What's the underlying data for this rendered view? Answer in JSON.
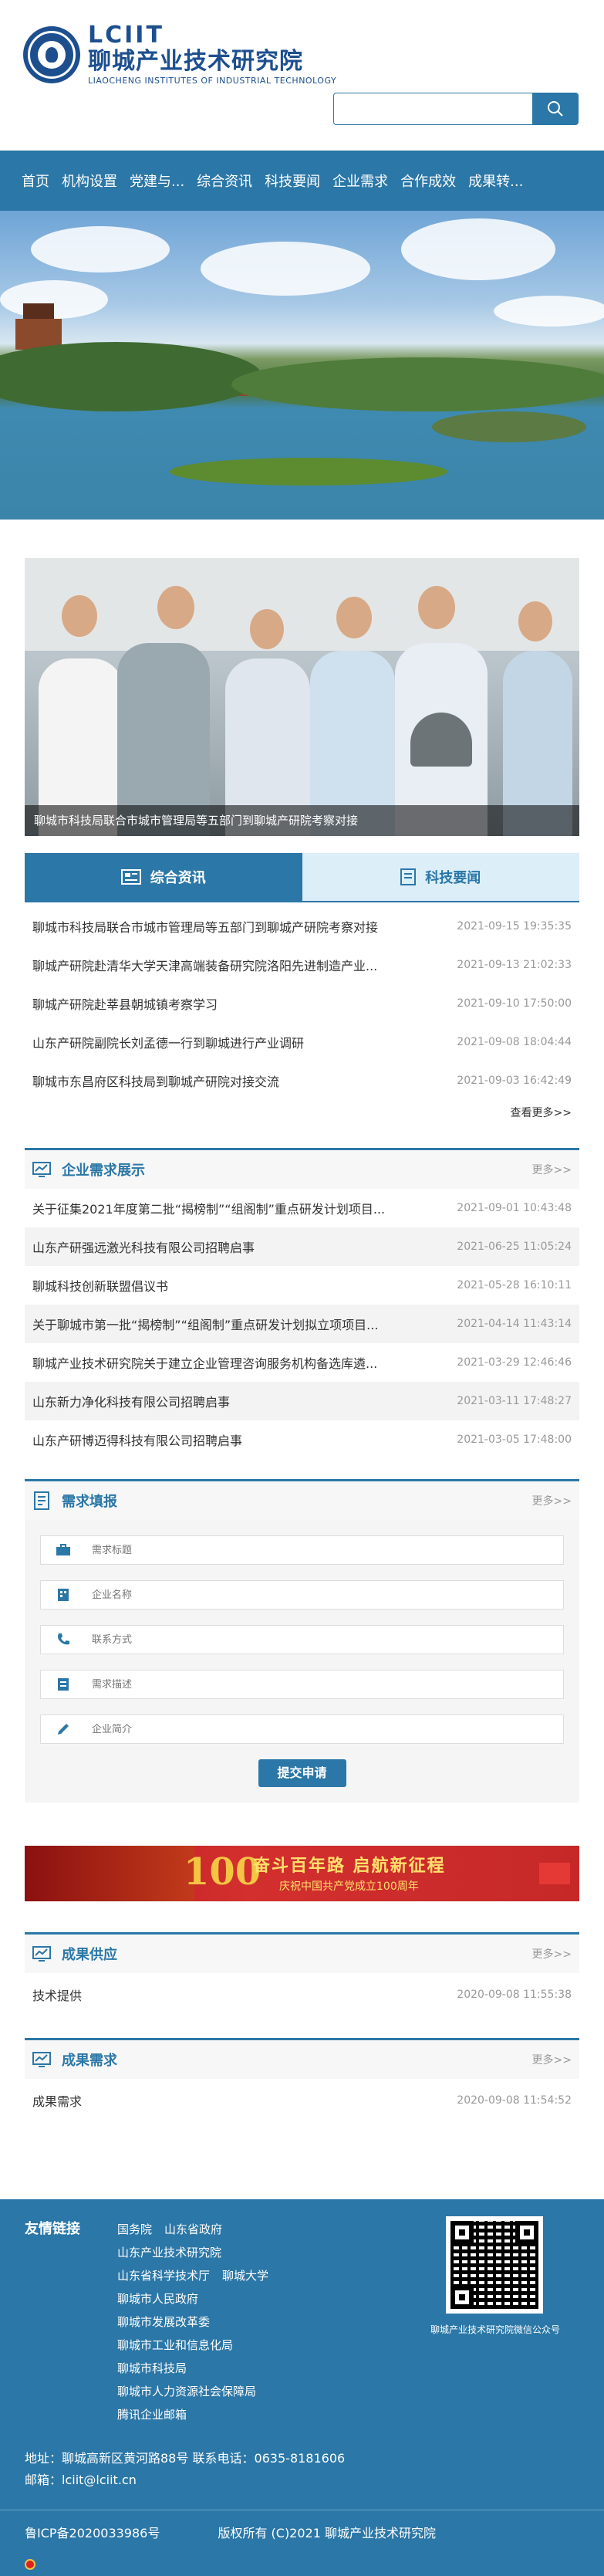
{
  "header": {
    "logo_en": "LCIIT",
    "logo_cn": "聊城产业技术研究院",
    "logo_sub": "LIAOCHENG INSTITUTES OF INDUSTRIAL TECHNOLOGY",
    "search_placeholder": ""
  },
  "nav": {
    "items": [
      "首页",
      "机构设置",
      "党建与...",
      "综合资讯",
      "科技要闻",
      "企业需求",
      "合作成效",
      "成果转..."
    ]
  },
  "news_photo": {
    "caption": "聊城市科技局联合市城市管理局等五部门到聊城产研院考察对接"
  },
  "tabs": {
    "active": "综合资讯",
    "inactive": "科技要闻"
  },
  "news_list": [
    {
      "title": "聊城市科技局联合市城市管理局等五部门到聊城产研院考察对接",
      "date": "2021-09-15 19:35:35"
    },
    {
      "title": "聊城产研院赴清华大学天津高端装备研究院洛阳先进制造产业...",
      "date": "2021-09-13 21:02:33"
    },
    {
      "title": "聊城产研院赴莘县朝城镇考察学习",
      "date": "2021-09-10 17:50:00"
    },
    {
      "title": "山东产研院副院长刘孟德一行到聊城进行产业调研",
      "date": "2021-09-08 18:04:44"
    },
    {
      "title": "聊城市东昌府区科技局到聊城产研院对接交流",
      "date": "2021-09-03 16:42:49"
    }
  ],
  "news_more": "查看更多>>",
  "demand": {
    "title": "企业需求展示",
    "more": "更多>>",
    "items": [
      {
        "title": "关于征集2021年度第二批“揭榜制”“组阁制”重点研发计划项目...",
        "date": "2021-09-01 10:43:48"
      },
      {
        "title": "山东产研强远激光科技有限公司招聘启事",
        "date": "2021-06-25 11:05:24"
      },
      {
        "title": "聊城科技创新联盟倡议书",
        "date": "2021-05-28 16:10:11"
      },
      {
        "title": "关于聊城市第一批“揭榜制”“组阁制”重点研发计划拟立项项目...",
        "date": "2021-04-14 11:43:14"
      },
      {
        "title": "聊城产业技术研究院关于建立企业管理咨询服务机构备选库遴...",
        "date": "2021-03-29 12:46:46"
      },
      {
        "title": "山东新力净化科技有限公司招聘启事",
        "date": "2021-03-11 17:48:27"
      },
      {
        "title": "山东产研博迈得科技有限公司招聘启事",
        "date": "2021-03-05 17:48:00"
      }
    ]
  },
  "form": {
    "title": "需求填报",
    "more": "更多>>",
    "fields": [
      "需求标题",
      "企业名称",
      "联系方式",
      "需求描述",
      "企业简介"
    ],
    "submit": "提交申请"
  },
  "party_banner": {
    "number": "100",
    "main": "奋斗百年路 启航新征程",
    "sub": "庆祝中国共产党成立100周年"
  },
  "supply": {
    "title": "成果供应",
    "more": "更多>>",
    "items": [
      {
        "title": "技术提供",
        "date": "2020-09-08 11:55:38"
      }
    ]
  },
  "achieve_demand": {
    "title": "成果需求",
    "more": "更多>>",
    "items": [
      {
        "title": "成果需求",
        "date": "2020-09-08 11:54:52"
      }
    ]
  },
  "footer": {
    "links_title": "友情链接",
    "links": [
      "国务院",
      "山东省政府",
      "山东产业技术研究院",
      "山东省科学技术厅",
      "聊城大学",
      "聊城市人民政府",
      "聊城市发展改革委",
      "聊城市工业和信息化局",
      "聊城市科技局",
      "聊城市人力资源社会保障局",
      "腾讯企业邮箱"
    ],
    "qr_caption": "聊城产业技术研究院微信公众号",
    "address": "地址：聊城高新区黄河路88号 联系电话：0635-8181606 邮箱：lciit@lciit.cn",
    "icp": "鲁ICP备2020033986号",
    "copyright": "版权所有 (C)2021 聊城产业技术研究院"
  },
  "colors": {
    "primary": "#2b77a7",
    "tab_inactive": "#dceef8",
    "date_gray": "#999999"
  }
}
